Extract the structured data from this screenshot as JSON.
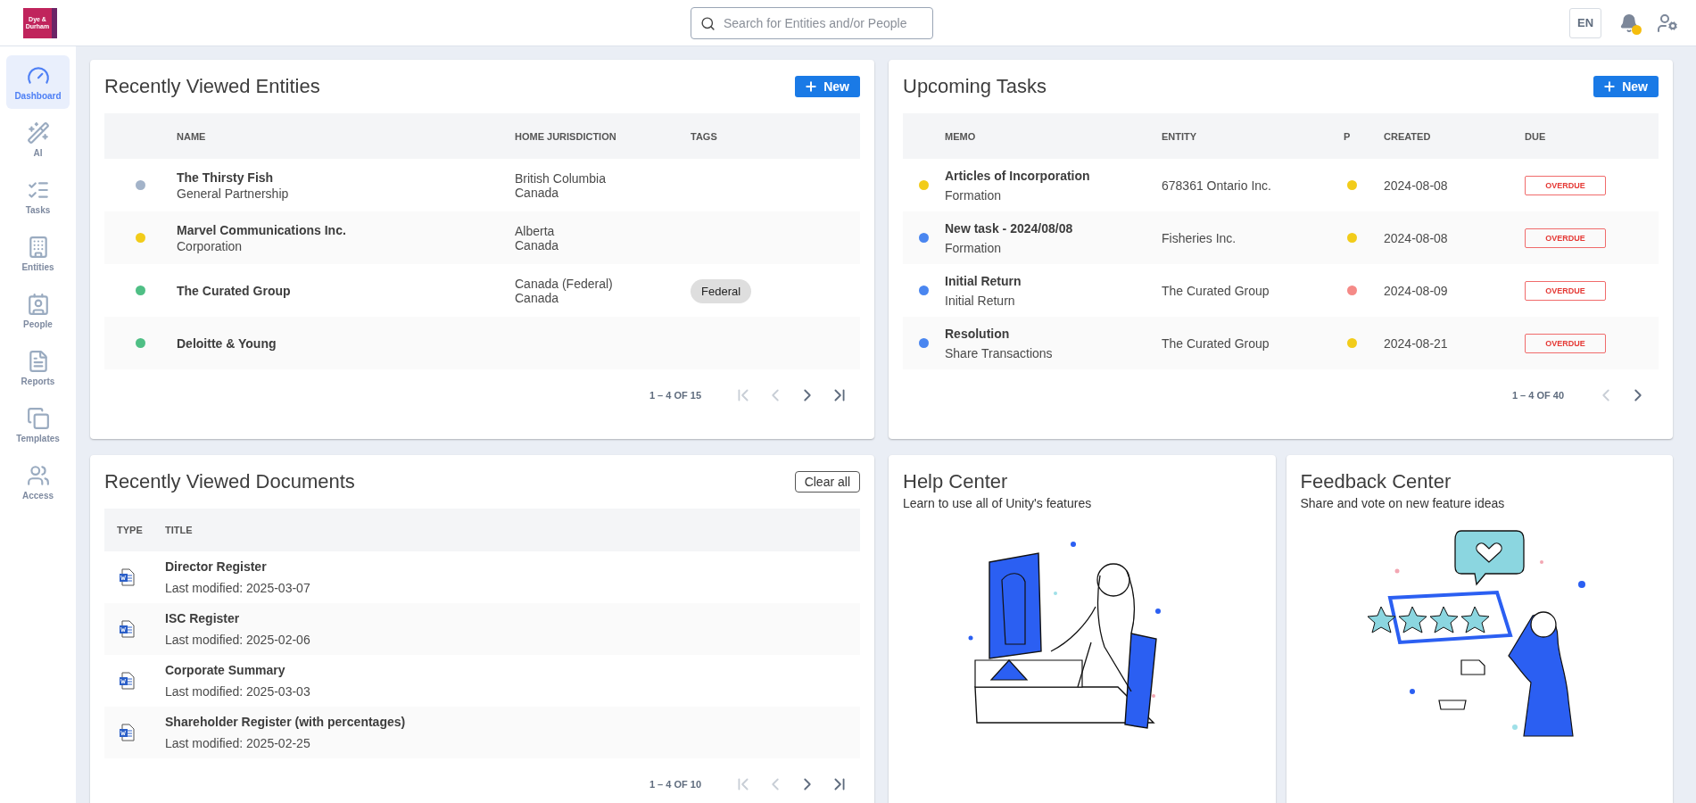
{
  "topbar": {
    "logo_lines": [
      "Dye &",
      "Durham"
    ],
    "search": {
      "placeholder": "Search for Entities and/or People"
    },
    "language": "EN",
    "notification_dot": true
  },
  "sidebar": {
    "items": [
      {
        "label": "Dashboard",
        "kind": "dashboard",
        "selected": true
      },
      {
        "label": "AI",
        "kind": "ai",
        "selected": false
      },
      {
        "label": "Tasks",
        "kind": "tasks",
        "selected": false
      },
      {
        "label": "Entities",
        "kind": "entities",
        "selected": false
      },
      {
        "label": "People",
        "kind": "people",
        "selected": false
      },
      {
        "label": "Reports",
        "kind": "reports",
        "selected": false
      },
      {
        "label": "Templates",
        "kind": "templates",
        "selected": false
      },
      {
        "label": "Access",
        "kind": "access",
        "selected": false
      }
    ]
  },
  "entities": {
    "title": "Recently Viewed Entities",
    "new_button": "New",
    "columns": [
      "NAME",
      "HOME JURISDICTION",
      "TAGS"
    ],
    "rows": [
      {
        "name": "The Thirsty Fish",
        "type": "General Partnership",
        "jurisdiction": [
          "British Columbia",
          "Canada"
        ],
        "tags": [],
        "color": "#a3b3c9"
      },
      {
        "name": "Marvel Communications Inc.",
        "type": "Corporation",
        "jurisdiction": [
          "Alberta",
          "Canada"
        ],
        "tags": [],
        "color": "#f2cc1a"
      },
      {
        "name": "The Curated Group",
        "jurisdiction": [
          "Canada (Federal)",
          "Canada"
        ],
        "tags": [
          "Federal"
        ],
        "color": "#4fbf85"
      },
      {
        "name": "Deloitte & Young",
        "jurisdiction": [],
        "tags": [],
        "color": "#4fbf85"
      }
    ],
    "pagination": {
      "range": "1 – 4 OF 15",
      "buttons": [
        {
          "kind": "first",
          "disabled": true
        },
        {
          "kind": "prev",
          "disabled": true
        },
        {
          "kind": "next",
          "disabled": false
        },
        {
          "kind": "last",
          "disabled": false
        }
      ]
    }
  },
  "tasks": {
    "title": "Upcoming Tasks",
    "new_button": "New",
    "columns": [
      "MEMO",
      "ENTITY",
      "P",
      "CREATED",
      "DUE"
    ],
    "rows": [
      {
        "memo": "Articles of Incorporation",
        "category": "Formation",
        "color": "#f2cc1a",
        "entity": "678361 Ontario Inc.",
        "priority": {
          "color": "#f2cc1a"
        },
        "created": "2024-08-08",
        "due": "OVERDUE"
      },
      {
        "memo": "New task - 2024/08/08",
        "category": "Formation",
        "color": "#4a86f0",
        "entity": "Fisheries Inc.",
        "priority": {
          "color": "#f2cc1a"
        },
        "created": "2024-08-08",
        "due": "OVERDUE"
      },
      {
        "memo": "Initial Return",
        "category": "Initial Return",
        "color": "#4a86f0",
        "entity": "The Curated Group",
        "priority": {
          "color": "#f58a87"
        },
        "created": "2024-08-09",
        "due": "OVERDUE"
      },
      {
        "memo": "Resolution",
        "category": "Share Transactions",
        "color": "#4a86f0",
        "entity": "The Curated Group",
        "priority": {
          "color": "#f2cc1a"
        },
        "created": "2024-08-21",
        "due": "OVERDUE"
      }
    ],
    "pagination": {
      "range": "1 – 4 OF 40",
      "buttons": [
        {
          "kind": "prev",
          "disabled": true
        },
        {
          "kind": "next",
          "disabled": false
        }
      ]
    }
  },
  "documents": {
    "title": "Recently Viewed Documents",
    "clear_button": "Clear all",
    "columns": [
      "TYPE",
      "TITLE"
    ],
    "rows": [
      {
        "title": "Director Register",
        "modified": "Last modified: 2025-03-07"
      },
      {
        "title": "ISC Register",
        "modified": "Last modified: 2025-02-06"
      },
      {
        "title": "Corporate Summary",
        "modified": "Last modified: 2025-03-03"
      },
      {
        "title": "Shareholder Register (with percentages)",
        "modified": "Last modified: 2025-02-25"
      }
    ],
    "pagination": {
      "range": "1 – 4 OF 10",
      "buttons": [
        {
          "kind": "first",
          "disabled": true
        },
        {
          "kind": "prev",
          "disabled": true
        },
        {
          "kind": "next",
          "disabled": false
        },
        {
          "kind": "last",
          "disabled": false
        }
      ]
    }
  },
  "help": {
    "title": "Help Center",
    "subtitle": "Learn to use all of Unity's features"
  },
  "feedback": {
    "title": "Feedback Center",
    "subtitle": "Share and vote on new feature ideas"
  }
}
